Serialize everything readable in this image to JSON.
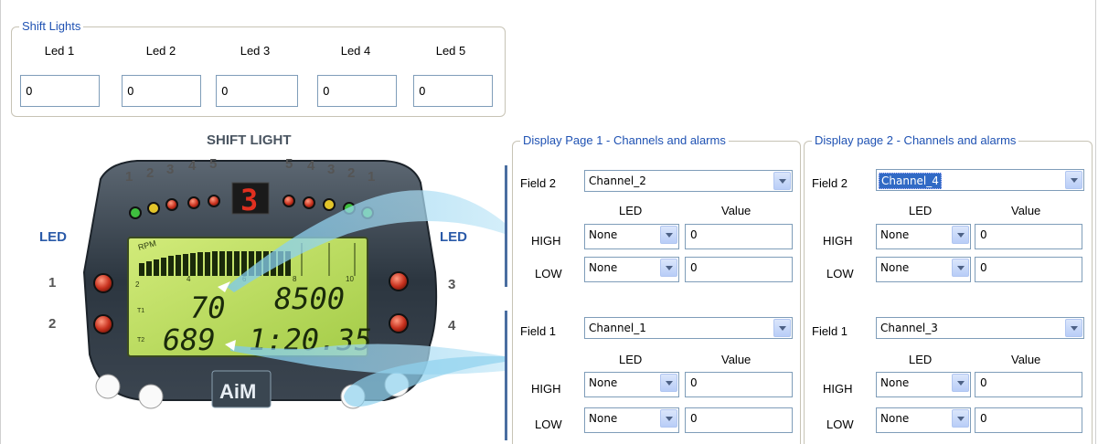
{
  "shift_lights": {
    "title": "Shift Lights",
    "leds": [
      {
        "label": "Led 1",
        "value": "0"
      },
      {
        "label": "Led 2",
        "value": "0"
      },
      {
        "label": "Led 3",
        "value": "0"
      },
      {
        "label": "Led 4",
        "value": "0"
      },
      {
        "label": "Led 5",
        "value": "0"
      }
    ]
  },
  "device": {
    "shift_light_label": "SHIFT LIGHT",
    "led_left_label": "LED",
    "led_right_label": "LED",
    "left_numbers": [
      "1",
      "2",
      "3",
      "4",
      "5"
    ],
    "right_numbers": [
      "5",
      "4",
      "3",
      "2",
      "1"
    ],
    "side_left": [
      "1",
      "2"
    ],
    "side_right": [
      "3",
      "4"
    ],
    "gear": "3",
    "rpm_label": "RPM",
    "t1_label": "T1",
    "t2_label": "T2",
    "value_t1": "70",
    "value_rpm": "8500",
    "value_t2": "689",
    "value_lap": "1:20.35",
    "scale": [
      "2",
      "4",
      "6",
      "8",
      "10"
    ],
    "logo": "AiM"
  },
  "page1": {
    "title": "Display Page 1 - Channels and alarms",
    "field2": {
      "label": "Field 2",
      "channel": "Channel_2",
      "led_header": "LED",
      "value_header": "Value",
      "high": {
        "label": "HIGH",
        "led": "None",
        "value": "0"
      },
      "low": {
        "label": "LOW",
        "led": "None",
        "value": "0"
      }
    },
    "field1": {
      "label": "Field 1",
      "channel": "Channel_1",
      "led_header": "LED",
      "value_header": "Value",
      "high": {
        "label": "HIGH",
        "led": "None",
        "value": "0"
      },
      "low": {
        "label": "LOW",
        "led": "None",
        "value": "0"
      }
    }
  },
  "page2": {
    "title": "Display page 2 - Channels and alarms",
    "field2": {
      "label": "Field 2",
      "channel": "Channel_4",
      "led_header": "LED",
      "value_header": "Value",
      "high": {
        "label": "HIGH",
        "led": "None",
        "value": "0"
      },
      "low": {
        "label": "LOW",
        "led": "None",
        "value": "0"
      }
    },
    "field1": {
      "label": "Field 1",
      "channel": "Channel_3",
      "led_header": "LED",
      "value_header": "Value",
      "high": {
        "label": "HIGH",
        "led": "None",
        "value": "0"
      },
      "low": {
        "label": "LOW",
        "led": "None",
        "value": "0"
      }
    }
  },
  "colors": {
    "group_title": "#1f52b3",
    "lcd_green": "#b6d85a",
    "led_red": "#d63a2a",
    "led_green": "#3fbf3f",
    "led_yellow": "#e3c52a"
  }
}
